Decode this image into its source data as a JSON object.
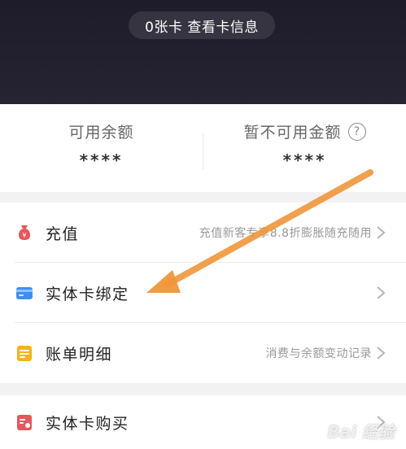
{
  "header": {
    "card_info": "0张卡 查看卡信息"
  },
  "balance": {
    "available_label": "可用余额",
    "available_value": "****",
    "unavailable_label": "暂不可用金额",
    "unavailable_value": "****",
    "help_glyph": "?"
  },
  "menu": {
    "items": [
      {
        "label": "充值",
        "desc": "充值新客专享8.8折膨胀随充随用",
        "icon": "money-bag-icon",
        "icon_color": "#e2585d"
      },
      {
        "label": "实体卡绑定",
        "desc": "",
        "icon": "card-icon",
        "icon_color": "#3d8ff0"
      },
      {
        "label": "账单明细",
        "desc": "消费与余额变动记录",
        "icon": "bill-icon",
        "icon_color": "#f2b41c"
      },
      {
        "label": "实体卡购买",
        "desc": "",
        "icon": "card-purchase-icon",
        "icon_color": "#e2585d"
      }
    ]
  },
  "overlay": {
    "annotation_arrow_color": "#f0963a",
    "watermark": "Bai 经验"
  }
}
